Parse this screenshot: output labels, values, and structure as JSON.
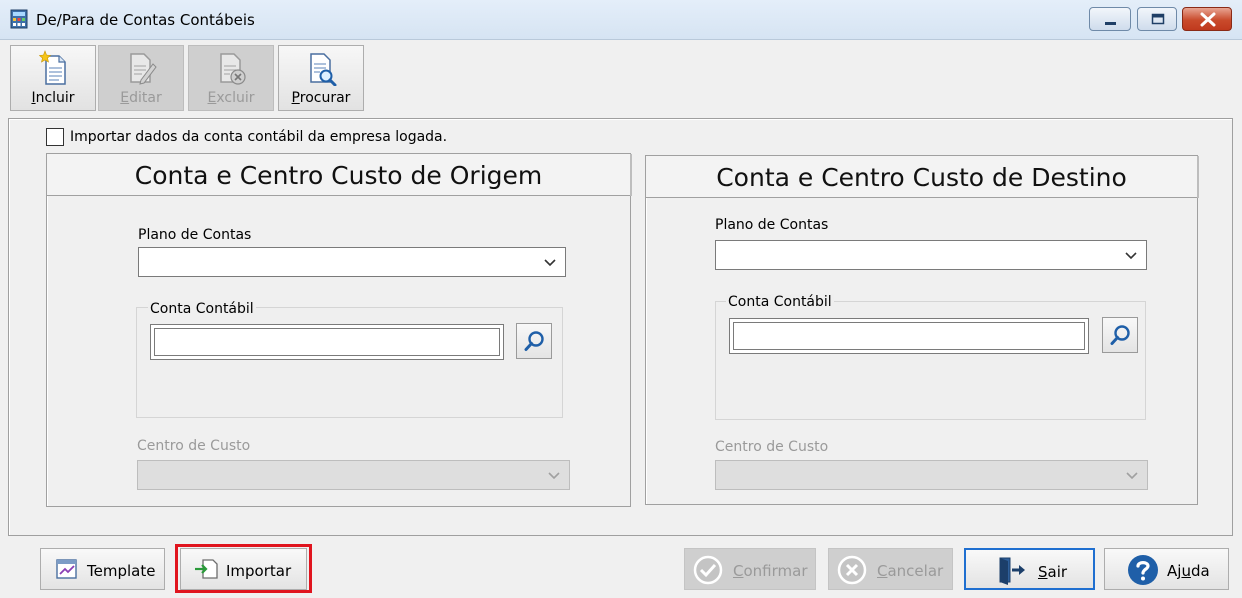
{
  "window": {
    "title": "De/Para de Contas Contábeis"
  },
  "toolbar": {
    "incluir": {
      "pre": "",
      "mn": "I",
      "post": "ncluir"
    },
    "editar": {
      "pre": "",
      "mn": "E",
      "post": "ditar"
    },
    "excluir": {
      "pre": "",
      "mn": "E",
      "post": "xcluir"
    },
    "procurar": {
      "pre": "",
      "mn": "P",
      "post": "rocurar"
    }
  },
  "import_checkbox": {
    "label": "Importar dados da conta contábil da empresa logada.",
    "checked": false
  },
  "origem": {
    "header": "Conta e Centro Custo de Origem",
    "plano_label": "Plano de Contas",
    "plano_value": "",
    "conta_label": "Conta Contábil",
    "conta_value": "",
    "centro_label": "Centro de Custo",
    "centro_value": ""
  },
  "destino": {
    "header": "Conta e Centro Custo de Destino",
    "plano_label": "Plano de Contas",
    "plano_value": "",
    "conta_label": "Conta Contábil",
    "conta_value": "",
    "centro_label": "Centro de Custo",
    "centro_value": ""
  },
  "buttons": {
    "template": {
      "pre": "",
      "mn": "",
      "post": "Template"
    },
    "importar": {
      "pre": "",
      "mn": "",
      "post": "Importar"
    },
    "confirmar": {
      "pre": "",
      "mn": "C",
      "post": "onfirmar"
    },
    "cancelar": {
      "pre": "",
      "mn": "C",
      "post": "ancelar"
    },
    "sair": {
      "pre": "",
      "mn": "S",
      "post": "air"
    },
    "ajuda": {
      "pre": "Aj",
      "mn": "u",
      "post": "da"
    }
  },
  "colors": {
    "highlight": "#e0141e",
    "focus": "#1f6fd0",
    "window_bar": "#d6e4f3"
  },
  "icons": [
    "calculator-icon",
    "new-document-icon",
    "edit-document-icon",
    "delete-document-icon",
    "search-document-icon",
    "magnifier-icon",
    "chevron-down-icon",
    "template-icon",
    "import-icon",
    "check-circle-icon",
    "cancel-circle-icon",
    "exit-door-icon",
    "help-icon"
  ]
}
